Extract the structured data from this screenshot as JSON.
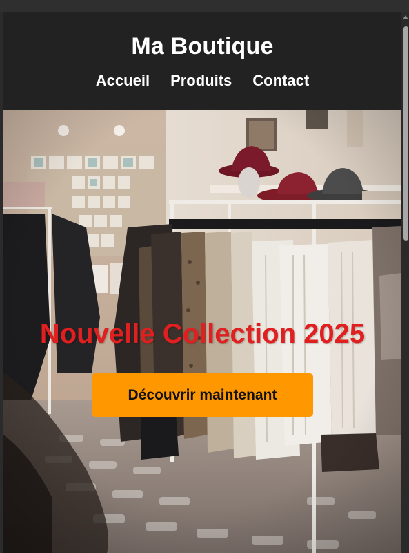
{
  "site": {
    "title": "Ma Boutique",
    "nav": [
      {
        "label": "Accueil"
      },
      {
        "label": "Produits"
      },
      {
        "label": "Contact"
      }
    ]
  },
  "hero": {
    "headline": "Nouvelle Collection 2025",
    "cta_label": "Découvrir maintenant",
    "image_icon": "clothing-store-photo"
  },
  "colors": {
    "header_bg": "#222222",
    "header_text": "#ffffff",
    "headline": "#e02020",
    "cta_bg": "#ff9800",
    "cta_text": "#111111"
  }
}
